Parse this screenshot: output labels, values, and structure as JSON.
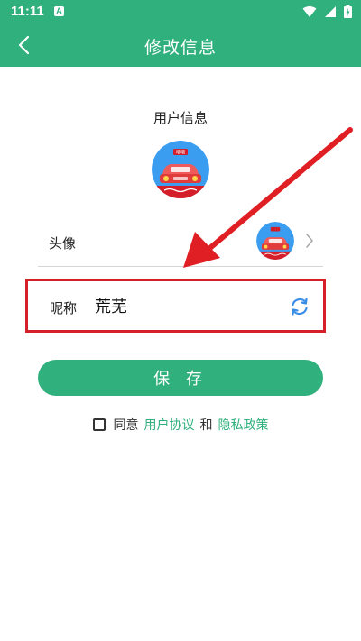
{
  "status_bar": {
    "time": "11:11",
    "notification_letter": "A",
    "icons": [
      "wifi-icon",
      "signal-icon",
      "battery-icon"
    ]
  },
  "header": {
    "back_icon": "chevron-left-icon",
    "title": "修改信息"
  },
  "profile": {
    "section_title": "用户信息",
    "avatar_badge_text": "嘀嘀",
    "avatar_row_label": "头像",
    "nickname_label": "昵称",
    "nickname_value": "荒芜",
    "refresh_icon": "refresh-icon"
  },
  "actions": {
    "save_label": "保 存"
  },
  "agreement": {
    "prefix": "同意",
    "user_agreement": "用户协议",
    "and": "和",
    "privacy_policy": "隐私政策"
  },
  "colors": {
    "brand_green": "#2fb07c",
    "highlight_red": "#d3202a",
    "refresh_blue": "#3a8ee6"
  }
}
